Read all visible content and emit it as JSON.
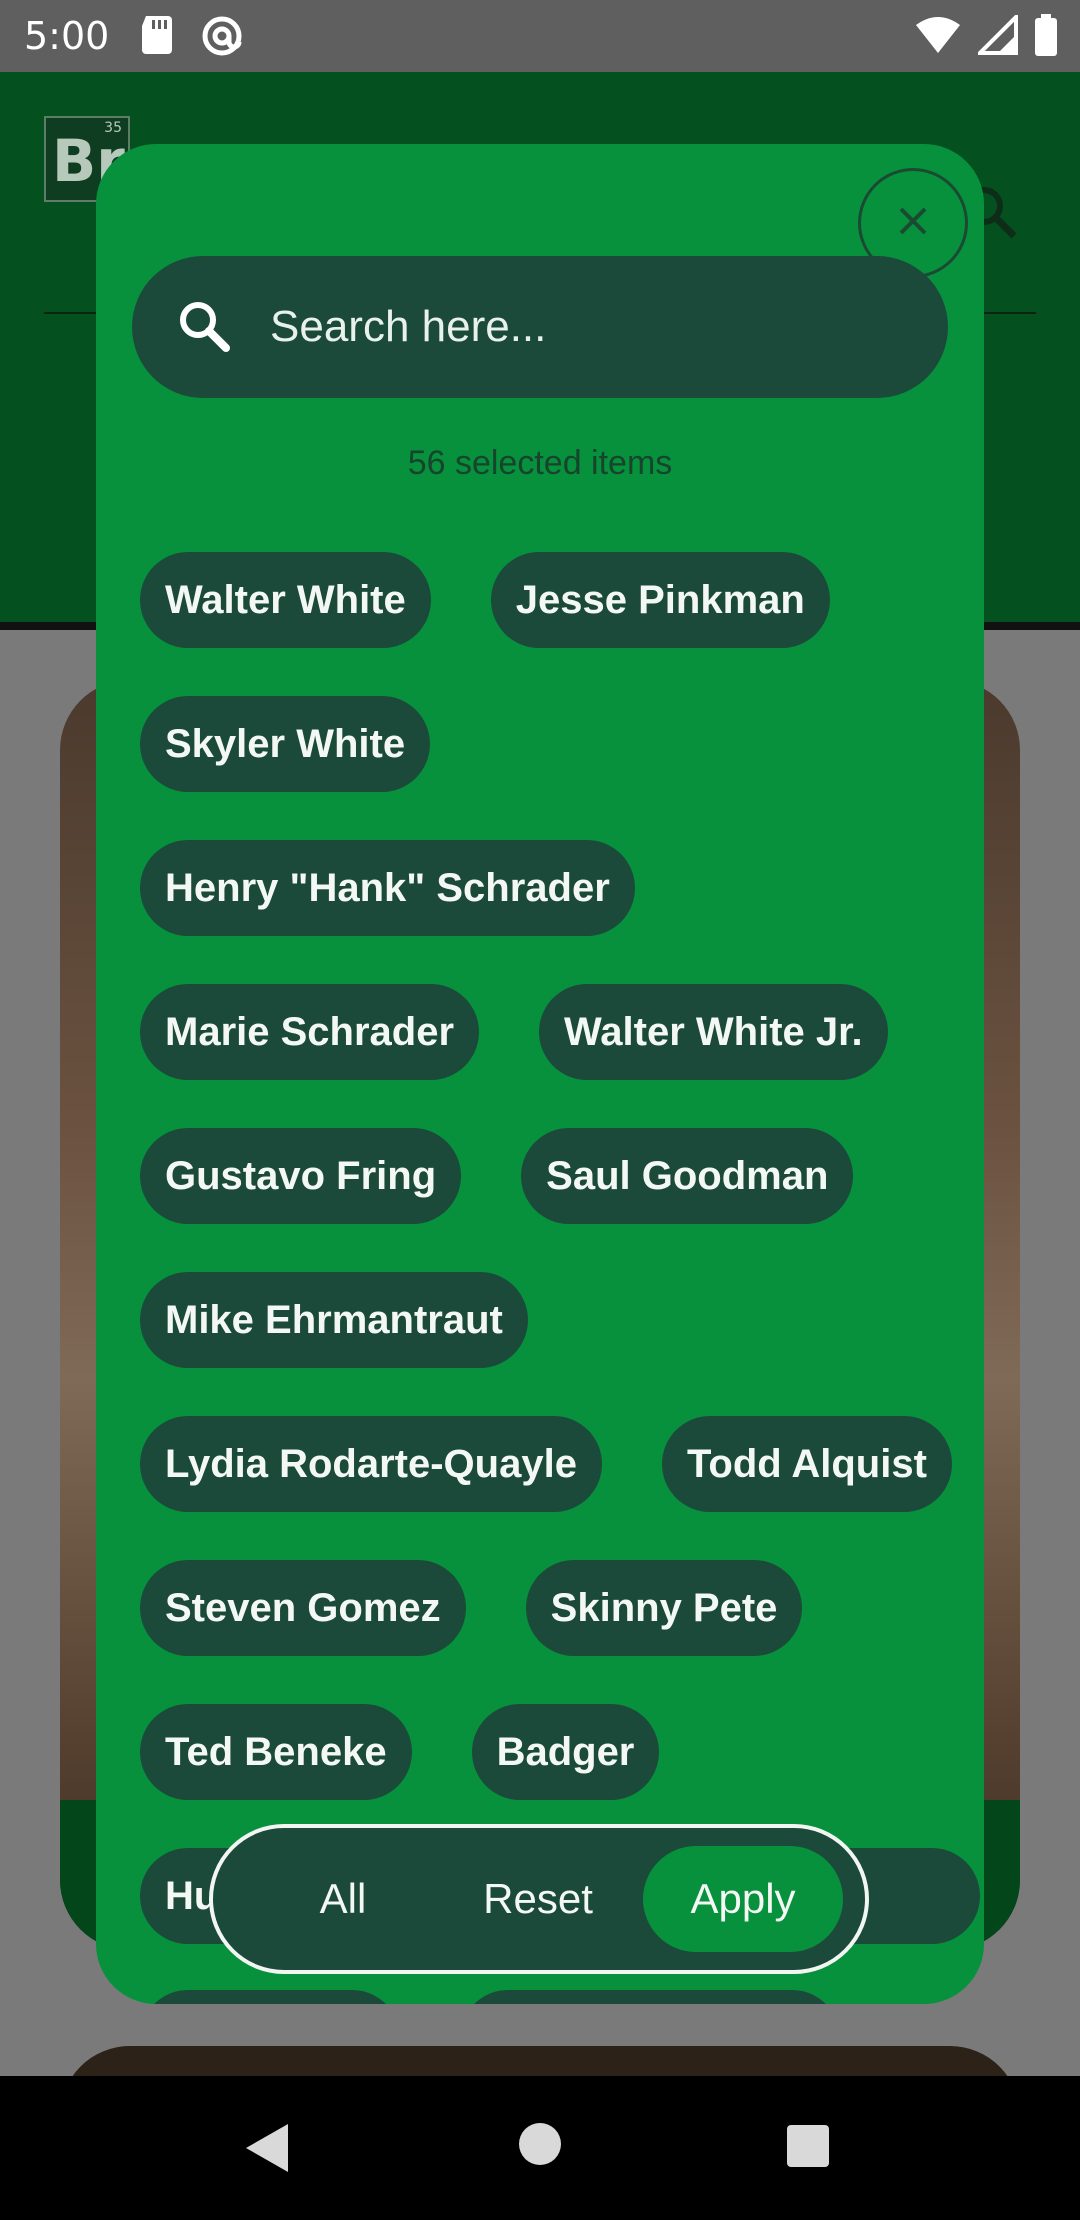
{
  "status_bar": {
    "time": "5:00",
    "left_icons": [
      "sd-card-icon",
      "at-sign-icon"
    ],
    "right_icons": [
      "wifi-icon",
      "signal-icon",
      "battery-icon"
    ]
  },
  "background_app": {
    "logo_text": "Br",
    "logo_number": "35"
  },
  "modal": {
    "search": {
      "placeholder": "Search here..."
    },
    "selected_count": "56 selected items",
    "chips": [
      [
        "Walter White",
        "Jesse Pinkman"
      ],
      [
        "Skyler White"
      ],
      [
        "Henry \"Hank\" Schrader"
      ],
      [
        "Marie Schrader",
        "Walter White Jr."
      ],
      [
        "Gustavo Fring",
        "Saul Goodman"
      ],
      [
        "Mike Ehrmantraut"
      ],
      [
        "Lydia Rodarte-Quayle",
        "Todd Alquist"
      ],
      [
        "Steven Gomez",
        "Skinny Pete"
      ],
      [
        "Ted Beneke",
        "Badger"
      ]
    ],
    "partial_chip_left": "Hu",
    "actions": {
      "all": "All",
      "reset": "Reset",
      "apply": "Apply"
    }
  },
  "colors": {
    "modal_bg": "#07913d",
    "chip_bg": "#1b4a3a",
    "header_bg": "#04501f"
  }
}
